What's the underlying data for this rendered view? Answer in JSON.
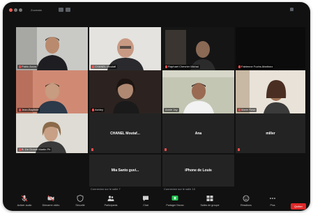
{
  "window": {
    "title": "Zoomata"
  },
  "tiles": [
    {
      "name": "Pablo Arcos"
    },
    {
      "name": "CHANEL Moutafi"
    },
    {
      "name": "Raphael Chevrier Michal"
    },
    {
      "name": "Fabienne Fuchs-Martinez"
    },
    {
      "name": "Jean-Baptiste"
    },
    {
      "name": "Ashley"
    },
    {
      "name": "Annie Jay"
    },
    {
      "name": "Marie Rose"
    },
    {
      "name": "B. De Grandi Martin Ph"
    }
  ],
  "name_only_tiles": [
    {
      "name": "CHANEL Moutaf..."
    },
    {
      "name": "Ana"
    },
    {
      "name": "miller"
    },
    {
      "name": "Mia Santo guvi..."
    },
    {
      "name": "iPhone de Louis"
    }
  ],
  "captions": {
    "left": "Connexion sur le salle 7",
    "right": "Connexion sur le salle 10"
  },
  "toolbar": {
    "items": [
      {
        "label": "Activer audio",
        "icon": "mic-icon"
      },
      {
        "label": "Démarrer vidéo",
        "icon": "video-icon"
      },
      {
        "label": "Sécurité",
        "icon": "shield-icon"
      },
      {
        "label": "Participants",
        "icon": "participants-icon"
      },
      {
        "label": "Chat",
        "icon": "chat-icon"
      },
      {
        "label": "Partager l'écran",
        "icon": "share-screen-icon"
      },
      {
        "label": "Salles de groupe",
        "icon": "breakout-icon"
      },
      {
        "label": "Réactions",
        "icon": "reactions-icon"
      },
      {
        "label": "Plus",
        "icon": "more-icon"
      }
    ],
    "leave_label": "Quitter"
  },
  "colors": {
    "background": "#111111",
    "speaking_border": "#a8d94c",
    "leave": "#e02828",
    "share_green": "#23c552",
    "muted_red": "#ff4d4d"
  }
}
